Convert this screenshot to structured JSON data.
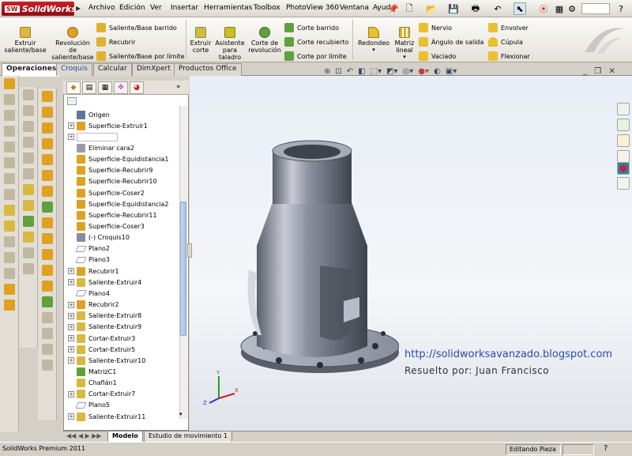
{
  "app": {
    "name": "SolidWorks",
    "logo_abbrev": "SW"
  },
  "menus": [
    "Archivo",
    "Edición",
    "Ver",
    "Insertar",
    "Herramientas",
    "Toolbox",
    "PhotoView 360",
    "Ventana",
    "Ayuda"
  ],
  "command_manager": {
    "big_buttons": [
      {
        "id": "extruir_saliente",
        "label": "Extruir saliente/base",
        "color": "#d8b840"
      },
      {
        "id": "revolucion",
        "label": "Revolución de saliente/base",
        "color": "#e0a020"
      },
      {
        "id": "extruir_corte",
        "label": "Extruir corte",
        "color": "#d8b840"
      },
      {
        "id": "asistente",
        "label": "Asistente para taladro",
        "color": "#c8c020"
      },
      {
        "id": "corte_revolucion",
        "label": "Corte de revolución",
        "color": "#60a040"
      },
      {
        "id": "redondeo",
        "label": "Redondeo",
        "color": "#e8c030"
      },
      {
        "id": "matriz",
        "label": "Matriz lineal",
        "color": "#d8b030"
      }
    ],
    "small_buttons_1": [
      "Saliente/Base barrido",
      "Recubrir",
      "Saliente/Base por límite"
    ],
    "small_buttons_2": [
      "Corte barrido",
      "Corte recubierto",
      "Corte por límite"
    ],
    "small_buttons_3": [
      "Nervio",
      "Ángulo de salida",
      "Vaciado"
    ],
    "small_buttons_4": [
      "Envolver",
      "Cúpula",
      "Flexionar"
    ]
  },
  "tabs": [
    "Operaciones",
    "Croquis",
    "Calcular",
    "DimXpert",
    "Productos Office"
  ],
  "active_tab": "Operaciones",
  "feature_tree": [
    {
      "label": "Origen",
      "expandable": false,
      "icon": "origin-icon"
    },
    {
      "label": "Superficie-Extruir1",
      "expandable": true,
      "icon": "surface-extrude-icon"
    },
    {
      "label": "",
      "expandable": true,
      "icon": "blank-icon",
      "editing": true
    },
    {
      "label": "Eliminar cara2",
      "expandable": false,
      "icon": "delete-face-icon"
    },
    {
      "label": "Superficie-Equidistancia1",
      "expandable": false,
      "icon": "surface-offset-icon"
    },
    {
      "label": "Superficie-Recubrir9",
      "expandable": false,
      "icon": "surface-loft-icon"
    },
    {
      "label": "Superficie-Recubrir10",
      "expandable": false,
      "icon": "surface-loft-icon"
    },
    {
      "label": "Superficie-Coser2",
      "expandable": false,
      "icon": "surface-knit-icon"
    },
    {
      "label": "Superficie-Equidistancia2",
      "expandable": false,
      "icon": "surface-offset-icon"
    },
    {
      "label": "Superficie-Recubrir11",
      "expandable": false,
      "icon": "surface-loft-icon"
    },
    {
      "label": "Superficie-Coser3",
      "expandable": false,
      "icon": "surface-knit-icon"
    },
    {
      "label": "(-) Croquis10",
      "expandable": false,
      "icon": "sketch-icon"
    },
    {
      "label": "Plano2",
      "expandable": false,
      "icon": "plane-icon"
    },
    {
      "label": "Plano3",
      "expandable": false,
      "icon": "plane-icon"
    },
    {
      "label": "Recubrir1",
      "expandable": true,
      "icon": "loft-icon"
    },
    {
      "label": "Saliente-Extruir4",
      "expandable": true,
      "icon": "boss-extrude-icon"
    },
    {
      "label": "Plano4",
      "expandable": false,
      "icon": "plane-icon"
    },
    {
      "label": "Recubrir2",
      "expandable": true,
      "icon": "loft-icon"
    },
    {
      "label": "Saliente-Extruir8",
      "expandable": true,
      "icon": "boss-extrude-icon"
    },
    {
      "label": "Saliente-Extruir9",
      "expandable": true,
      "icon": "boss-extrude-icon"
    },
    {
      "label": "Cortar-Extruir3",
      "expandable": true,
      "icon": "cut-extrude-icon"
    },
    {
      "label": "Cortar-Extruir5",
      "expandable": true,
      "icon": "cut-extrude-icon"
    },
    {
      "label": "Saliente-Extruir10",
      "expandable": true,
      "icon": "boss-extrude-icon"
    },
    {
      "label": "MatrizC1",
      "expandable": false,
      "icon": "circular-pattern-icon"
    },
    {
      "label": "Chaflán1",
      "expandable": false,
      "icon": "chamfer-icon"
    },
    {
      "label": "Cortar-Extruir7",
      "expandable": true,
      "icon": "cut-extrude-icon"
    },
    {
      "label": "Plano5",
      "expandable": false,
      "icon": "plane-icon"
    },
    {
      "label": "Saliente-Extruir11",
      "expandable": true,
      "icon": "boss-extrude-icon"
    }
  ],
  "bottom_tabs": [
    "Modelo",
    "Estudio de movimiento 1"
  ],
  "watermark": {
    "url": "http://solidworksavanzado.blogspot.com",
    "credit": "Resuelto por: Juan Francisco"
  },
  "status": {
    "product": "SolidWorks Premium 2011",
    "mode": "Editando Pieza"
  },
  "search_placeholder": "",
  "help_symbol": "?",
  "colors": {
    "accent": "#c8202a",
    "tree_plus": "#888888"
  }
}
